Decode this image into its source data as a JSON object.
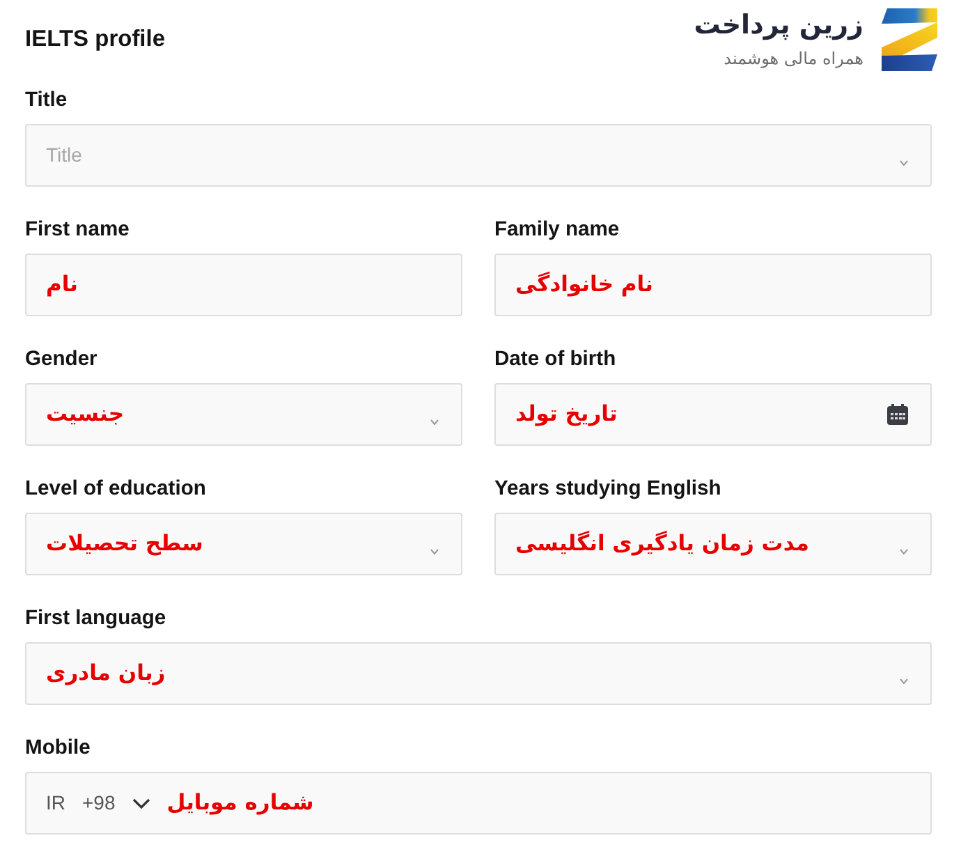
{
  "header": {
    "title": "IELTS profile",
    "brand": {
      "name": "زرین پرداخت",
      "tagline": "همراه مالی هوشمند"
    }
  },
  "rows": [
    {
      "title": {
        "label": "Title",
        "kind": "select",
        "placeholder": "Title"
      }
    },
    {
      "first_name": {
        "label": "First name",
        "kind": "text",
        "value": "نام"
      },
      "family_name": {
        "label": "Family name",
        "kind": "text",
        "value": "نام خانوادگی"
      }
    },
    {
      "gender": {
        "label": "Gender",
        "kind": "select",
        "value": "جنسیت"
      },
      "date_of_birth": {
        "label": "Date of birth",
        "kind": "date",
        "value": "تاریخ تولد"
      }
    },
    {
      "level_of_education": {
        "label": "Level of education",
        "kind": "select",
        "value": "سطح تحصیلات"
      },
      "years_studying_english": {
        "label": "Years studying English",
        "kind": "select",
        "value": "مدت زمان یادگیری انگلیسی"
      }
    },
    {
      "first_language": {
        "label": "First language",
        "kind": "select",
        "value": "زبان مادری"
      }
    },
    {
      "mobile": {
        "label": "Mobile",
        "kind": "phone",
        "country": "IR",
        "dial_code": "+98",
        "value": "شماره موبایل"
      }
    }
  ]
}
